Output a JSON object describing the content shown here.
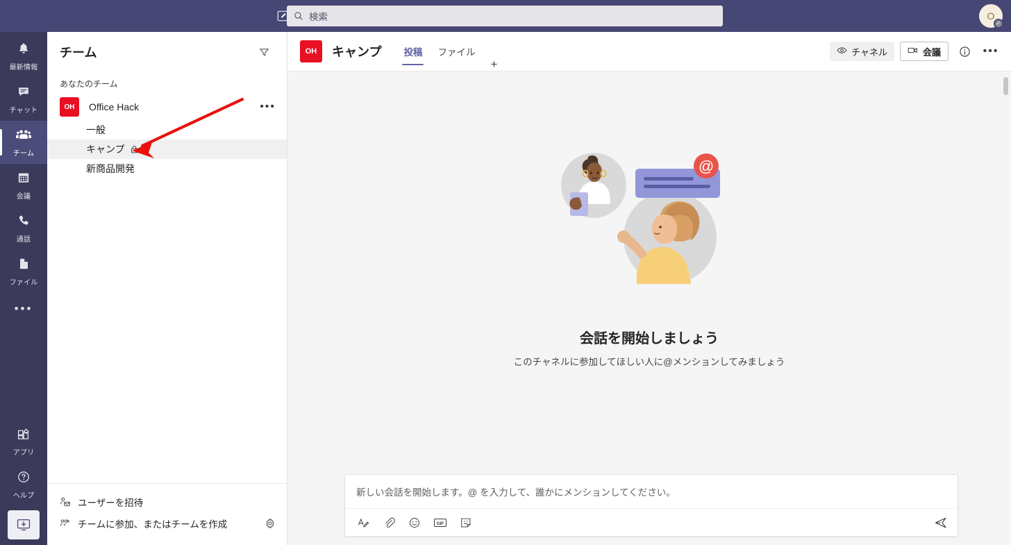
{
  "titlebar": {
    "compose_icon": "compose-pencil-icon",
    "search": {
      "placeholder": "検索",
      "icon": "search-icon"
    },
    "avatar": {
      "initial": "O",
      "status_icon": "✓",
      "name": "user-avatar"
    }
  },
  "rail": {
    "items": [
      {
        "label": "最新情報",
        "icon": "bell-icon",
        "active": false
      },
      {
        "label": "チャット",
        "icon": "chat-icon",
        "active": false
      },
      {
        "label": "チーム",
        "icon": "teams-people-icon",
        "active": true
      },
      {
        "label": "会議",
        "icon": "calendar-icon",
        "active": false
      },
      {
        "label": "通話",
        "icon": "phone-icon",
        "active": false
      },
      {
        "label": "ファイル",
        "icon": "files-icon",
        "active": false
      }
    ],
    "more_label": "•••",
    "bottom": [
      {
        "label": "アプリ",
        "icon": "apps-icon"
      },
      {
        "label": "ヘルプ",
        "icon": "help-question-icon"
      }
    ],
    "download_icon": "download-desktop-app-icon"
  },
  "sidebar": {
    "title": "チーム",
    "filter_icon": "filter-funnel-icon",
    "section_label": "あなたのチーム",
    "team": {
      "avatar_initials": "OH",
      "name": "Office Hack",
      "more_label": "•••"
    },
    "channels": [
      {
        "name": "一般",
        "selected": false,
        "private": false
      },
      {
        "name": "キャンプ",
        "selected": true,
        "private": true
      },
      {
        "name": "新商品開発",
        "selected": false,
        "private": false
      }
    ],
    "footer": [
      {
        "label": "ユーザーを招待",
        "icon": "invite-user-icon"
      },
      {
        "label": "チームに参加、またはチームを作成",
        "icon": "join-create-team-icon"
      }
    ],
    "settings_icon": "gear-icon"
  },
  "channel_header": {
    "avatar_initials": "OH",
    "title": "キャンプ",
    "tabs": [
      {
        "label": "投稿",
        "active": true
      },
      {
        "label": "ファイル",
        "active": false
      }
    ],
    "add_tab_label": "+",
    "actions": {
      "channel_button": {
        "label": "チャネル",
        "icon": "eye-icon"
      },
      "meet_button": {
        "label": "会議",
        "icon": "video-camera-icon"
      },
      "info_icon": "info-circle-icon",
      "more_label": "•••"
    }
  },
  "canvas": {
    "illustration_name": "start-conversation-illustration",
    "empty_title": "会話を開始しましょう",
    "empty_subtitle": "このチャネルに参加してほしい人に@メンションしてみましょう",
    "mention_badge": "@"
  },
  "compose": {
    "placeholder": "新しい会話を開始します。@ を入力して、誰かにメンションしてください。",
    "value": "",
    "toolbar": [
      {
        "icon": "format-text-icon"
      },
      {
        "icon": "attach-paperclip-icon"
      },
      {
        "icon": "emoji-smiley-icon"
      },
      {
        "icon": "gif-icon",
        "label": "GIF"
      },
      {
        "icon": "sticker-icon"
      }
    ],
    "send_icon": "send-icon"
  },
  "annotation": {
    "type": "arrow",
    "color": "#e8110e",
    "points_to": "キャンプ"
  },
  "colors": {
    "titlebar": "#464775",
    "rail": "#3b3a5a",
    "rail_active": "#4c4c7a",
    "accent": "#6264a7",
    "team_avatar": "#e81123",
    "selected_row": "#f0f0f0",
    "canvas": "#f5f5f5",
    "annotation_red": "#e8110e"
  }
}
